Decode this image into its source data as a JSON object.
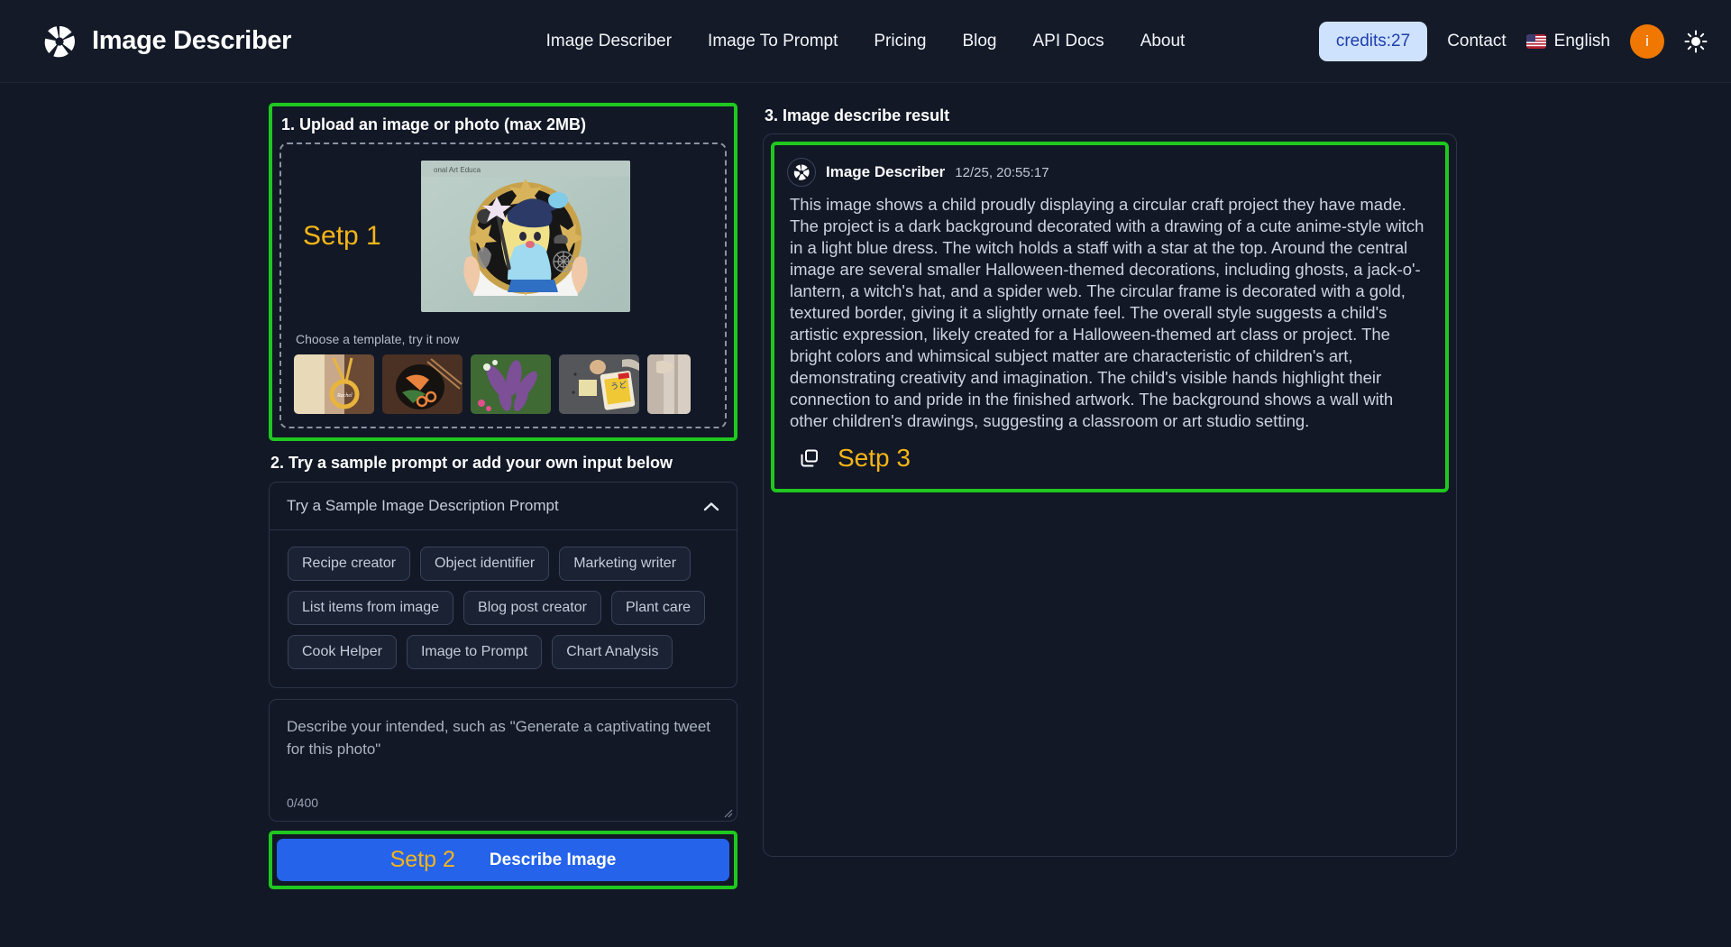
{
  "header": {
    "brand": "Image Describer",
    "logo_icon": "aperture-icon",
    "nav": [
      {
        "label": "Image Describer"
      },
      {
        "label": "Image To Prompt"
      },
      {
        "label": "Pricing"
      },
      {
        "label": "Blog"
      },
      {
        "label": "API Docs"
      },
      {
        "label": "About"
      }
    ],
    "credits": "credits:27",
    "contact": "Contact",
    "flag_icon": "us-flag-icon",
    "language": "English",
    "avatar_initial": "i",
    "theme_icon": "sun-icon",
    "accent_credits_bg": "#cfe2fd",
    "accent_credits_fg": "#1e3fae",
    "avatar_color": "#f07800"
  },
  "upload": {
    "title": "1. Upload an image or photo (max 2MB)",
    "step_badge": "Setp 1",
    "template_label": "Choose a template, try it now",
    "highlight_color": "#1fc81f",
    "step_color": "#f5b517",
    "thumbnails": [
      {
        "name": "gold-necklace-thumbnail"
      },
      {
        "name": "salmon-bowl-thumbnail"
      },
      {
        "name": "purple-plant-thumbnail"
      },
      {
        "name": "udon-package-thumbnail"
      },
      {
        "name": "clipped-thumbnail"
      }
    ]
  },
  "prompt": {
    "title": "2. Try a sample prompt or add your own input below",
    "dropdown_label": "Try a Sample Image Description Prompt",
    "dropdown_icon": "chevron-up-icon",
    "tags": [
      "Recipe creator",
      "Object identifier",
      "Marketing writer",
      "List items from image",
      "Blog post creator",
      "Plant care",
      "Cook Helper",
      "Image to Prompt",
      "Chart Analysis"
    ],
    "textarea_placeholder": "Describe your intended, such as \"Generate a captivating tweet for this photo\"",
    "char_count": "0/400",
    "submit_step": "Setp 2",
    "submit_label": "Describe Image",
    "submit_color": "#2563eb"
  },
  "result": {
    "title": "3. Image describe result",
    "author": "Image Describer",
    "author_icon": "aperture-icon",
    "timestamp": "12/25, 20:55:17",
    "body": "This image shows a child proudly displaying a circular craft project they have made. The project is a dark background decorated with a drawing of a cute anime-style witch in a light blue dress. The witch holds a staff with a star at the top. Around the central image are several smaller Halloween-themed decorations, including ghosts, a jack-o'-lantern, a witch's hat, and a spider web. The circular frame is decorated with a gold, textured border, giving it a slightly ornate feel. The overall style suggests a child's artistic expression, likely created for a Halloween-themed art class or project. The bright colors and whimsical subject matter are characteristic of children's art, demonstrating creativity and imagination. The child's visible hands highlight their connection to and pride in the finished artwork. The background shows a wall with other children's drawings, suggesting a classroom or art studio setting.",
    "copy_icon": "copy-icon",
    "copy_step": "Setp 3"
  }
}
